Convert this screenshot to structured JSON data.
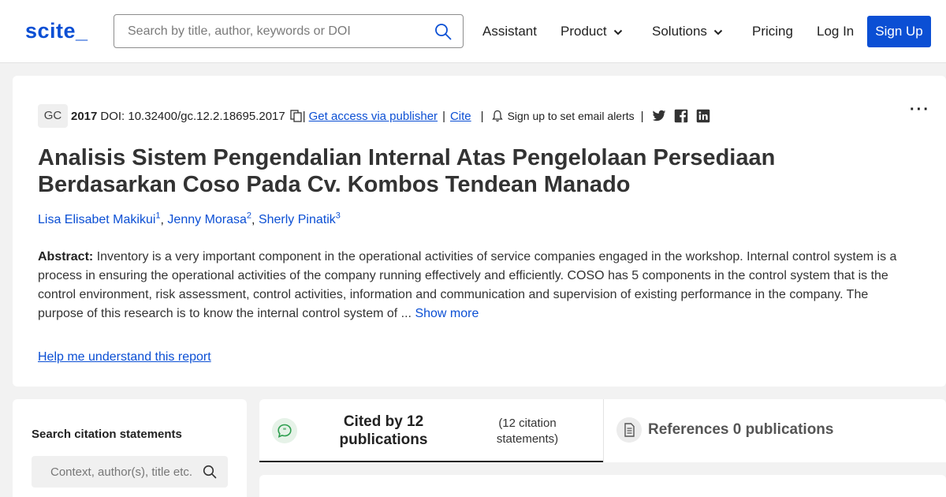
{
  "header": {
    "logo": "scite_",
    "search_placeholder": "Search by title, author, keywords or DOI",
    "nav": {
      "assistant": "Assistant",
      "product": "Product",
      "solutions": "Solutions",
      "pricing": "Pricing",
      "login": "Log In",
      "signup": "Sign Up"
    }
  },
  "colors": {
    "accent": "#0b4fd4",
    "background": "#f2f2f2"
  },
  "article": {
    "journal_badge": "GC",
    "year": "2017",
    "doi": "DOI: 10.32400/gc.12.2.18695.2017",
    "access_link": "Get access via publisher",
    "cite_link": "Cite",
    "alert_text": "Sign up to set email alerts",
    "more_menu": "···",
    "title": "Analisis Sistem Pengendalian Internal Atas Pengelolaan Persediaan Berdasarkan Coso Pada Cv. Kombos Tendean Manado",
    "authors": [
      {
        "name": "Lisa Elisabet Makikui",
        "sup": "1"
      },
      {
        "name": "Jenny Morasa",
        "sup": "2"
      },
      {
        "name": "Sherly Pinatik",
        "sup": "3"
      }
    ],
    "abstract_label": "Abstract:",
    "abstract_text": "Inventory is a very important component in the operational activities of service companies engaged in the workshop. Internal control system is a process in ensuring the operational activities of the company running effectively and efficiently. COSO has 5 components in the control system that is the control environment, risk assessment, control activities, information and communication and supervision of existing performance in the company. The purpose of this research is to know the internal control system of ...",
    "show_more": "Show more",
    "help_link": "Help me understand this report"
  },
  "sidebar": {
    "title": "Search citation statements",
    "search_placeholder": "Context, author(s), title etc."
  },
  "tabs": {
    "cited_label": "Cited by 12 publications",
    "cited_sub": "(12 citation statements)",
    "references_label": "References 0 publications"
  }
}
